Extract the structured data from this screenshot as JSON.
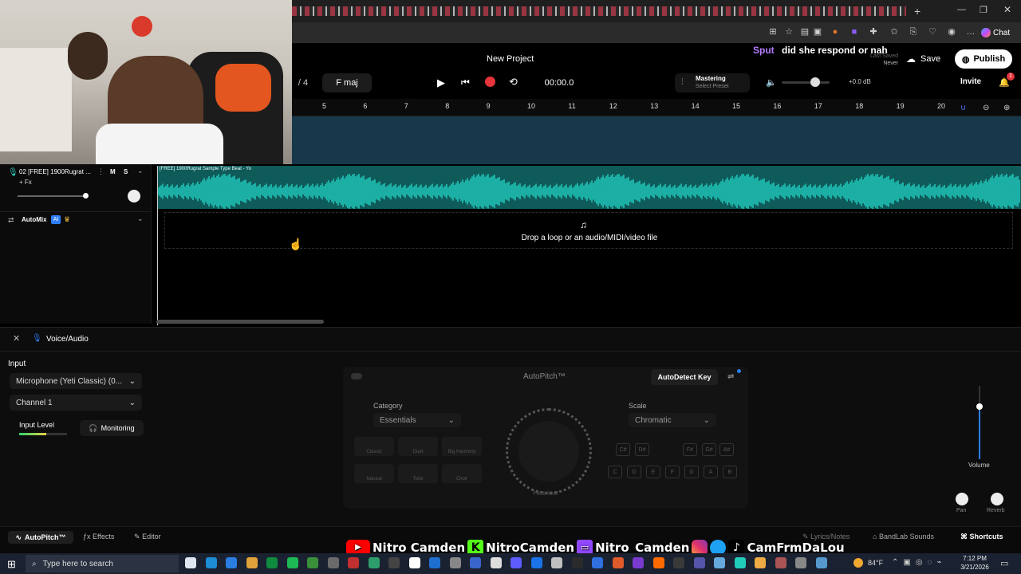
{
  "project": {
    "title": "New Project",
    "time_signature_fragment": "/ 4",
    "key": "F maj",
    "time": "00:00.0",
    "mastering_label": "Mastering",
    "mastering_sub": "Select Preset",
    "volume_db": "+0.0 dB",
    "last_saved_label": "Last Saved",
    "last_saved_value": "Never",
    "save_label": "Save",
    "publish_label": "Publish",
    "invite_label": "Invite",
    "notification_count": "1",
    "chat_label": "Chat"
  },
  "overlay_chat": {
    "user": "Sput",
    "message": "did she respond or nah"
  },
  "ruler": {
    "bars": [
      "5",
      "6",
      "7",
      "8",
      "9",
      "10",
      "11",
      "12",
      "13",
      "14",
      "15",
      "16",
      "17",
      "18",
      "19",
      "20"
    ]
  },
  "track": {
    "name": "02  [FREE] 1900Rugrat ...",
    "mute": "M",
    "solo": "S",
    "fx": "+ Fx",
    "clip_name": "[FREE] 1900Rugrat Sample Type Beat - Yo",
    "automix_label": "AutoMix",
    "automix_badge": "AI"
  },
  "dropzone": {
    "text": "Drop a loop or an audio/MIDI/video file"
  },
  "panel": {
    "header": "Voice/Audio",
    "input_label": "Input",
    "input_device": "Microphone (Yeti Classic) (0...",
    "channel": "Channel 1",
    "input_level_label": "Input Level",
    "monitoring_label": "Monitoring",
    "volume_label": "Volume",
    "pan_label": "Pan",
    "reverb_label": "Reverb"
  },
  "autopitch": {
    "title": "AutoPitch™",
    "autodetect_label": "AutoDetect Key",
    "category_label": "Category",
    "category_value": "Essentials",
    "scale_label": "Scale",
    "scale_value": "Chromatic",
    "knob_label": "Heaviest",
    "presets": [
      "Classic",
      "Duet",
      "Big Harmony",
      "Natural",
      "Tone",
      "Choir"
    ],
    "keys_top": [
      "C#\nDb",
      "D#\nEb",
      "F#\nGb",
      "G#\nAb",
      "A#\nBb"
    ],
    "keys_bottom": [
      "C",
      "D",
      "E",
      "F",
      "G",
      "A",
      "B"
    ]
  },
  "bottom_bar": {
    "tabs": [
      "AutoPitch™",
      "Effects",
      "Editor"
    ],
    "right_items": [
      "Lyrics/Notes",
      "BandLab Sounds",
      "Shortcuts"
    ]
  },
  "socials_overlay": {
    "youtube": "Nitro Camden",
    "kick": "NitroCamden",
    "twitch": "Nitro_Camden",
    "instagram_twitter_tiktok": "CamFrmDaLou"
  },
  "taskbar": {
    "search_placeholder": "Type here to search",
    "weather": "84°F",
    "time": "7:12 PM",
    "date": "3/21/2026"
  },
  "colors": {
    "waveform": "#22d3c5",
    "record": "#e5343a",
    "accent_blue": "#2d7ef7",
    "youtube": "#ff0000",
    "kick": "#53fc18",
    "twitch": "#9146ff"
  }
}
